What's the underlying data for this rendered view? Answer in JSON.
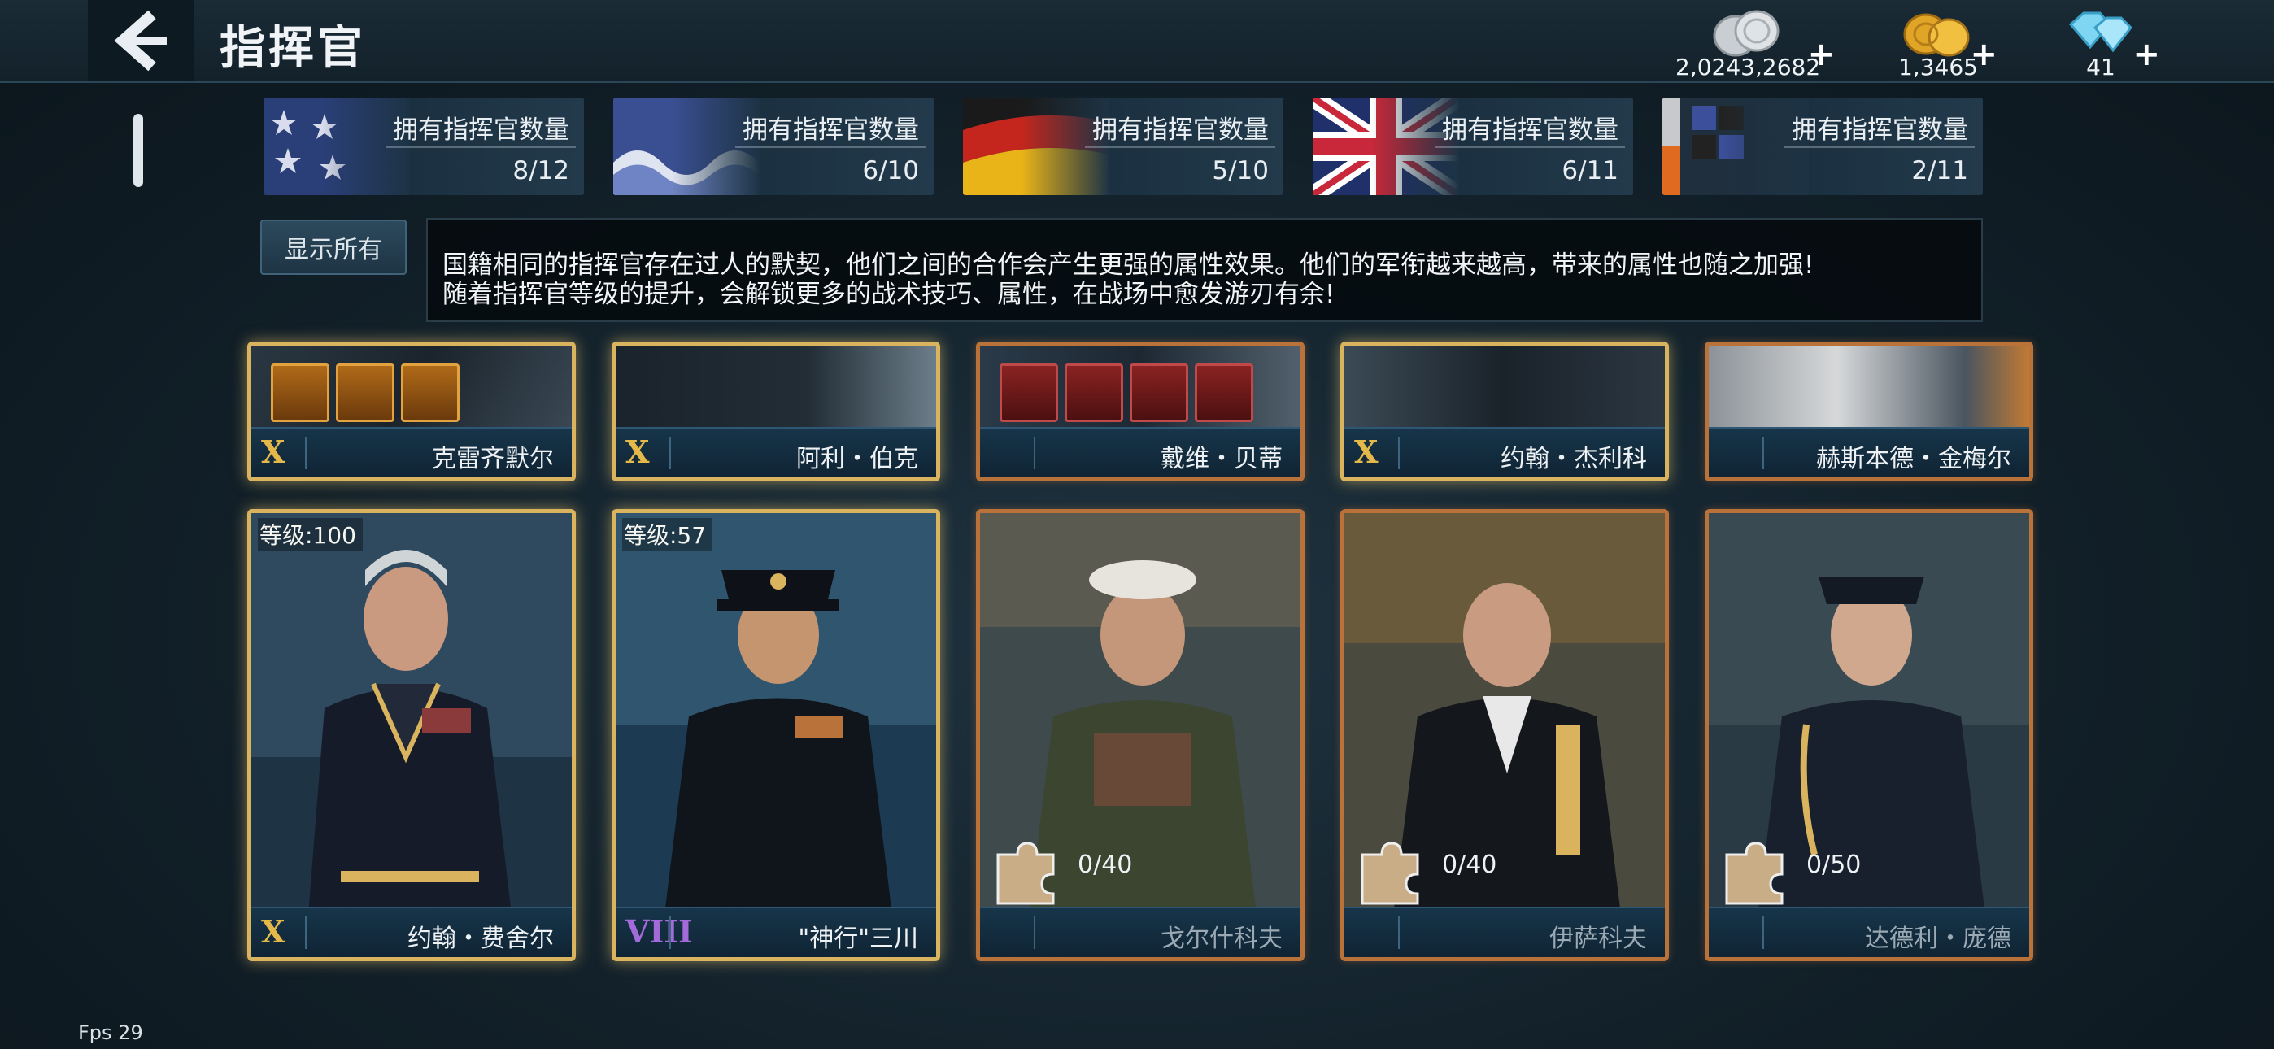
{
  "header": {
    "title": "指挥官"
  },
  "currencies": [
    {
      "name": "silver-coins-icon",
      "amount": "2,0243,2682",
      "plus": "+"
    },
    {
      "name": "gold-coins-icon",
      "amount": "1,3465",
      "plus": "+"
    },
    {
      "name": "diamonds-icon",
      "amount": "41",
      "plus": "+"
    }
  ],
  "nations": [
    {
      "flag": "usa",
      "label": "拥有指挥官数量",
      "count": "8/12"
    },
    {
      "flag": "japan",
      "label": "拥有指挥官数量",
      "count": "6/10"
    },
    {
      "flag": "germany",
      "label": "拥有指挥官数量",
      "count": "5/10"
    },
    {
      "flag": "uk",
      "label": "拥有指挥官数量",
      "count": "6/11"
    },
    {
      "flag": "other",
      "label": "拥有指挥官数量",
      "count": "2/11"
    }
  ],
  "show_all_button": "显示所有",
  "description": {
    "line1": "国籍相同的指挥官存在过人的默契，他们之间的合作会产生更强的属性效果。他们的军衔越来越高，带来的属性也随之加强!",
    "line2": "随着指挥官等级的提升，会解锁更多的战术技巧、属性，在战场中愈发游刃有余!"
  },
  "top_row": [
    {
      "name": "克雷齐默尔",
      "rank": "X",
      "frame": "gold",
      "equipment": [
        "medal-icon",
        "dagger-icon",
        "jacket-icon"
      ],
      "equip_style": "gold"
    },
    {
      "name": "阿利・伯克",
      "rank": "X",
      "frame": "gold",
      "equipment": [],
      "equip_style": ""
    },
    {
      "name": "戴维・贝蒂",
      "rank": "",
      "frame": "orange",
      "equipment": [
        "belt-icon",
        "binoculars-icon",
        "uniform-icon",
        "pipe-icon"
      ],
      "equip_style": "red"
    },
    {
      "name": "约翰・杰利科",
      "rank": "X",
      "frame": "gold",
      "equipment": [],
      "equip_style": ""
    },
    {
      "name": "赫斯本德・金梅尔",
      "rank": "",
      "frame": "orange",
      "equipment": [],
      "equip_style": ""
    }
  ],
  "bottom_row": [
    {
      "name": "约翰・费舍尔",
      "rank": "X",
      "level": "等级:100",
      "frame": "gold",
      "fragments": ""
    },
    {
      "name": "\"神行\"三川",
      "rank": "VIII",
      "level": "等级:57",
      "frame": "gold",
      "fragments": ""
    },
    {
      "name": "戈尔什科夫",
      "rank": "",
      "level": "",
      "frame": "orange",
      "fragments": "0/40"
    },
    {
      "name": "伊萨科夫",
      "rank": "",
      "level": "",
      "frame": "orange",
      "fragments": "0/40"
    },
    {
      "name": "达德利・庞德",
      "rank": "",
      "level": "",
      "frame": "orange",
      "fragments": "0/50"
    }
  ],
  "fps": "Fps 29",
  "colors": {
    "gold_frame": "#d9b35e",
    "orange_frame": "#b9733a",
    "rank_x": "#e5b84a",
    "rank_viii": "#a36bd9",
    "namebar": "#17354a"
  }
}
